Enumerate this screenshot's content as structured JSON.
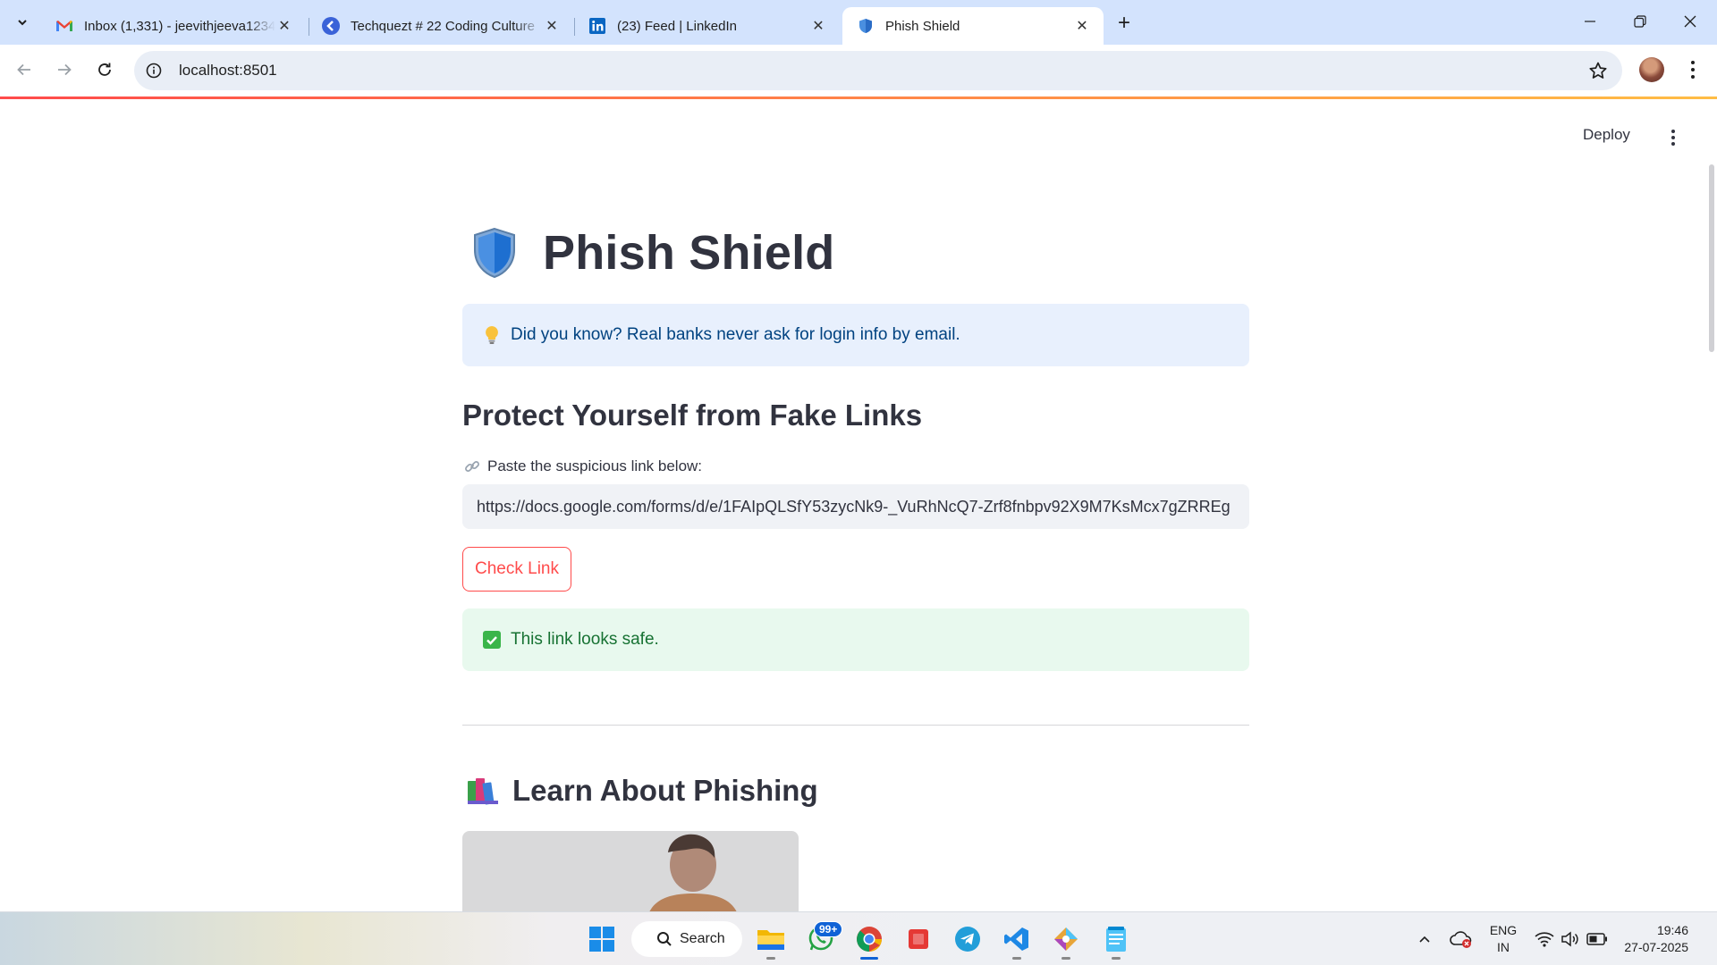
{
  "browser": {
    "tabs": [
      {
        "title": "Inbox (1,331) - jeevithjeeva1234",
        "icon": "gmail-icon",
        "close": "✕"
      },
      {
        "title": "Techquezt # 22 Coding Culture",
        "icon": "techquezt-icon",
        "close": "✕"
      },
      {
        "title": "(23) Feed | LinkedIn",
        "icon": "linkedin-icon",
        "close": "✕"
      },
      {
        "title": "Phish Shield",
        "icon": "shield-icon",
        "close": "✕"
      }
    ],
    "new_tab": "+",
    "url": "localhost:8501"
  },
  "app": {
    "deploy_label": "Deploy",
    "title": "Phish Shield",
    "tip": "Did you know? Real banks never ask for login info by email.",
    "subheader": "Protect Yourself from Fake Links",
    "input_label": "Paste the suspicious link below:",
    "input_value": "https://docs.google.com/forms/d/e/1FAIpQLSfY53zycNk9-_VuRhNcQ7-Zrf8fnbpv92X9M7KsMcx7gZRREg",
    "check_button": "Check Link",
    "result": "This link looks safe.",
    "learn_heading": "Learn About Phishing"
  },
  "taskbar": {
    "search_label": "Search",
    "whatsapp_badge": "99+",
    "lang_line1": "ENG",
    "lang_line2": "IN",
    "time": "19:46",
    "date": "27-07-2025"
  },
  "colors": {
    "accent": "#ff4b4b",
    "info_bg": "#e8f0fd",
    "success_bg": "#e8f9ee",
    "tabstrip": "#d3e3fd"
  }
}
